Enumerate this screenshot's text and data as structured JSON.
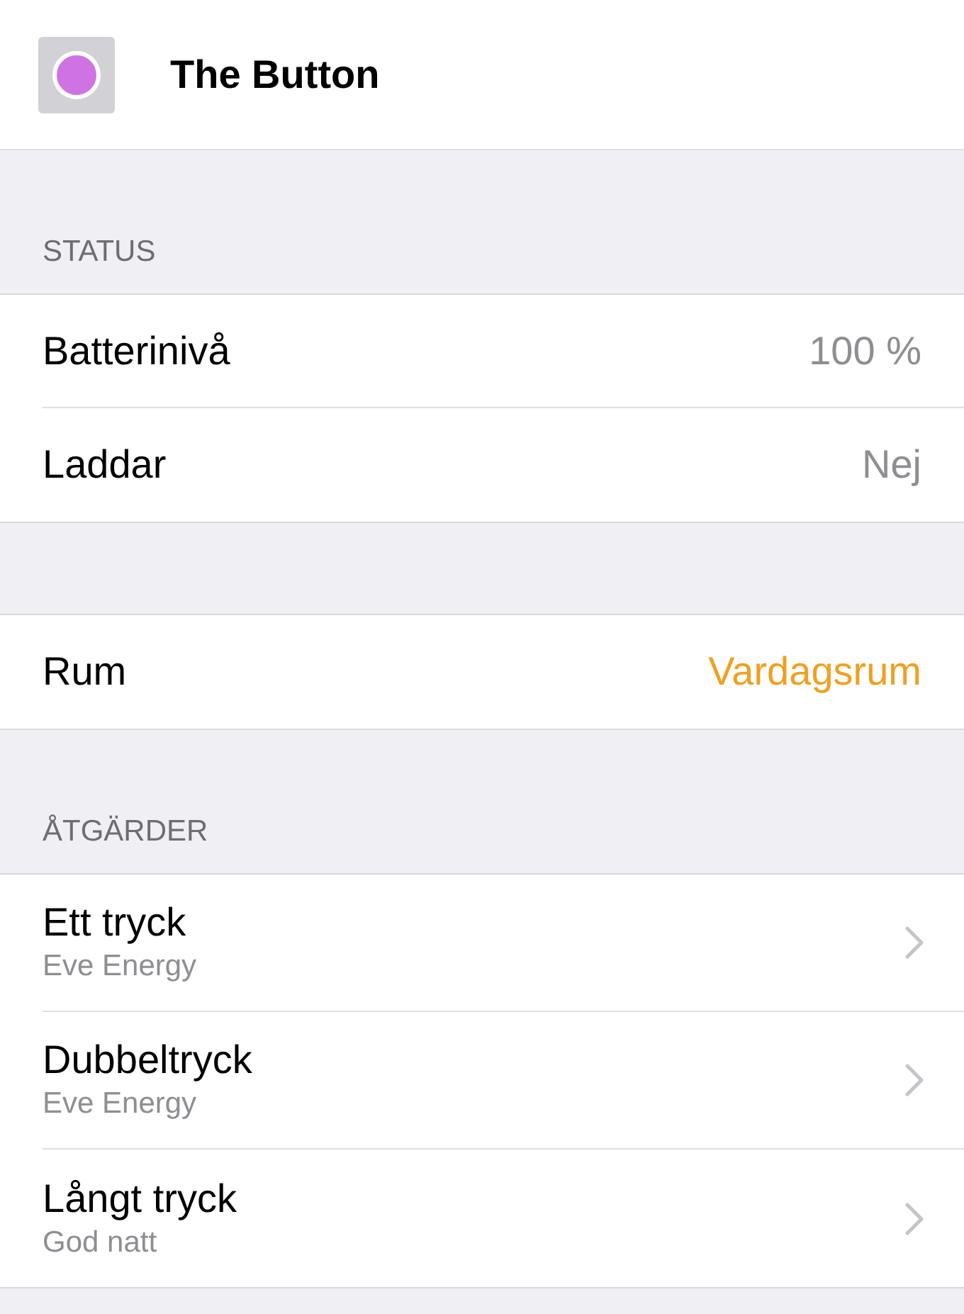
{
  "header": {
    "title": "The Button"
  },
  "sections": [
    {
      "heading": "STATUS",
      "rows": [
        {
          "label": "Batterinivå",
          "value": "100 %",
          "kind": "detail"
        },
        {
          "label": "Laddar",
          "value": "Nej",
          "kind": "detail"
        }
      ]
    },
    {
      "rows": [
        {
          "label": "Rum",
          "value": "Vardagsrum",
          "kind": "link"
        }
      ]
    },
    {
      "heading": "ÅTGÄRDER",
      "rows": [
        {
          "label": "Ett tryck",
          "subtitle": "Eve Energy",
          "kind": "nav"
        },
        {
          "label": "Dubbeltryck",
          "subtitle": "Eve Energy",
          "kind": "nav"
        },
        {
          "label": "Långt tryck",
          "subtitle": "God natt",
          "kind": "nav"
        }
      ]
    }
  ]
}
